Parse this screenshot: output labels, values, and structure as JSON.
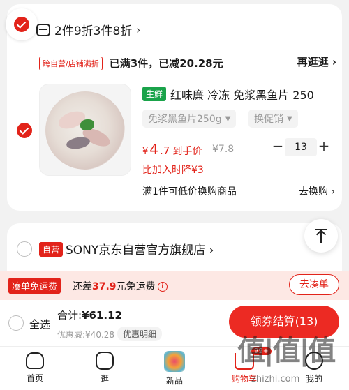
{
  "store_group": {
    "label": "2件9折3件8折",
    "chevron": "›"
  },
  "promo": {
    "tag": "跨自营/店铺满折",
    "text": "已满3件，已减20.28元",
    "more": "再逛逛 ›"
  },
  "item": {
    "badge": "生鲜",
    "title": "红味廉 冷冻 免浆黑鱼片 250",
    "spec": "免浆黑鱼片250g",
    "promo_select": "换促销",
    "price_cur": "¥",
    "price_int": "4",
    "price_dec": ".7",
    "price_label": "到手价",
    "orig_price": "¥7.8",
    "qty": "13",
    "qty_minus": "−",
    "qty_plus": "+",
    "drop_note": "比加入时降¥3",
    "swap_text": "满1件可低价换购商品",
    "swap_link": "去换购 ›"
  },
  "store2": {
    "badge": "自营",
    "name": "SONY京东自营官方旗舰店 ›"
  },
  "freeship": {
    "badge": "凑单免运费",
    "text_pre": "还差",
    "amount": "37.9",
    "text_post": "元免运费",
    "info": "i",
    "button": "去凑单"
  },
  "checkout": {
    "select_all": "全选",
    "total_label": "合计:",
    "total": "¥61.12",
    "discount": "优惠减:¥40.28",
    "detail": "优惠明细",
    "pay": "领券结算(13)"
  },
  "tabs": [
    {
      "label": "首页",
      "icon": "home-icon"
    },
    {
      "label": "逛",
      "icon": "discover-icon"
    },
    {
      "label": "新品",
      "icon": "new-icon"
    },
    {
      "label": "购物车",
      "icon": "cart-icon",
      "badge": "99+"
    },
    {
      "label": "我的",
      "icon": "profile-icon"
    }
  ],
  "watermark": {
    "mark": "值|值|值",
    "url": "zhizhi.com"
  },
  "colors": {
    "accent": "#e2231a",
    "fresh": "#1aa34a",
    "freeship_bg": "#fde8e4"
  }
}
